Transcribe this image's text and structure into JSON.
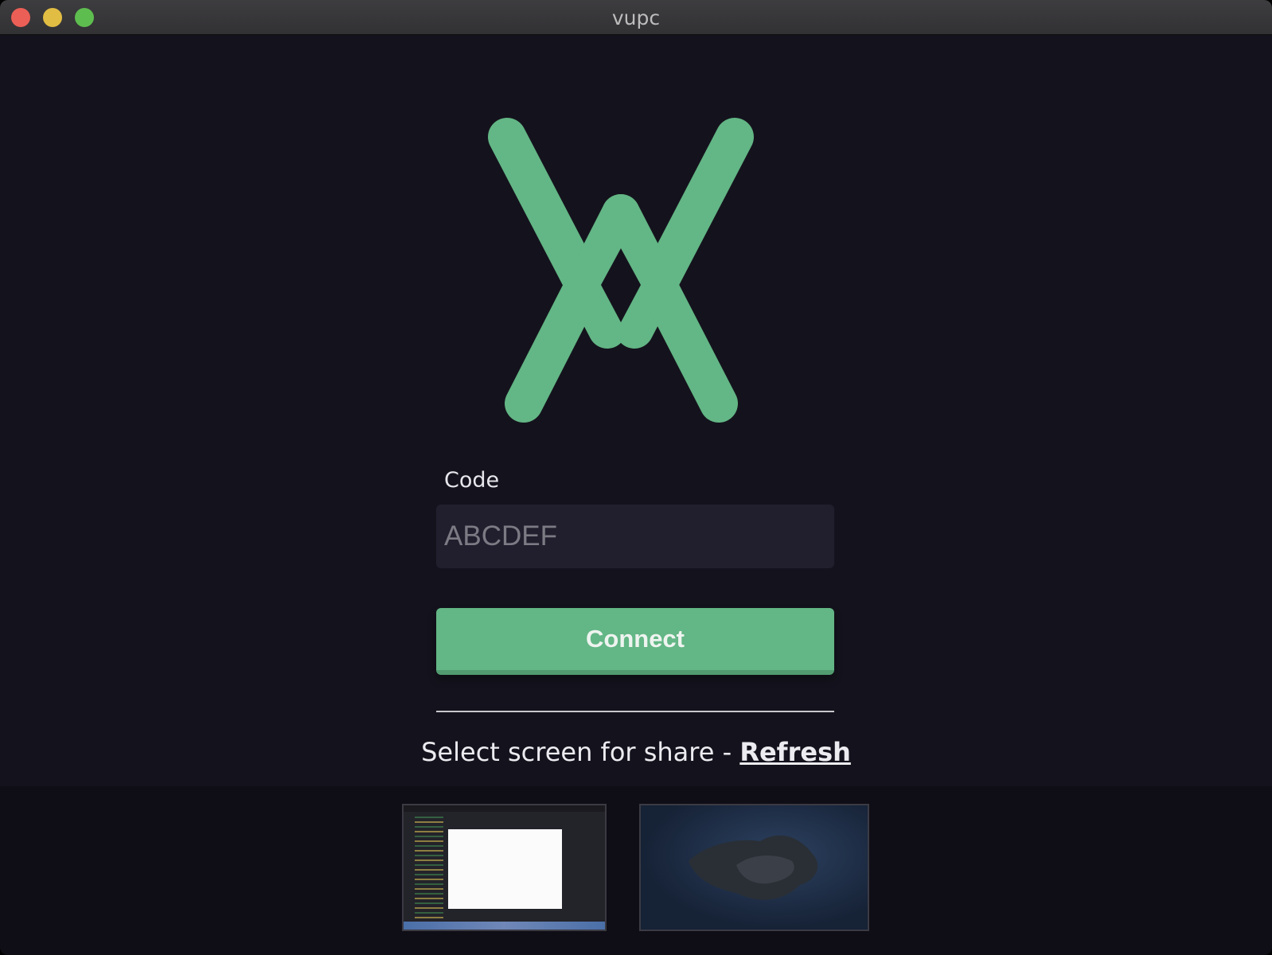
{
  "window": {
    "title": "vupc"
  },
  "logo": {
    "icon": "vupc-logo-icon",
    "color": "#63b685"
  },
  "form": {
    "code_label": "Code",
    "code_placeholder": "ABCDEF",
    "code_value": "",
    "connect_label": "Connect"
  },
  "share": {
    "prompt": "Select screen for share - ",
    "refresh_label": "Refresh"
  },
  "screens": [
    {
      "name": "screen-thumbnail-1"
    },
    {
      "name": "screen-thumbnail-2"
    }
  ],
  "colors": {
    "background": "#14131d",
    "accent": "#63b685",
    "input_background": "#211f2e",
    "close": "#ec5f56",
    "minimize": "#e1bd43",
    "maximize": "#5ebd4f"
  }
}
